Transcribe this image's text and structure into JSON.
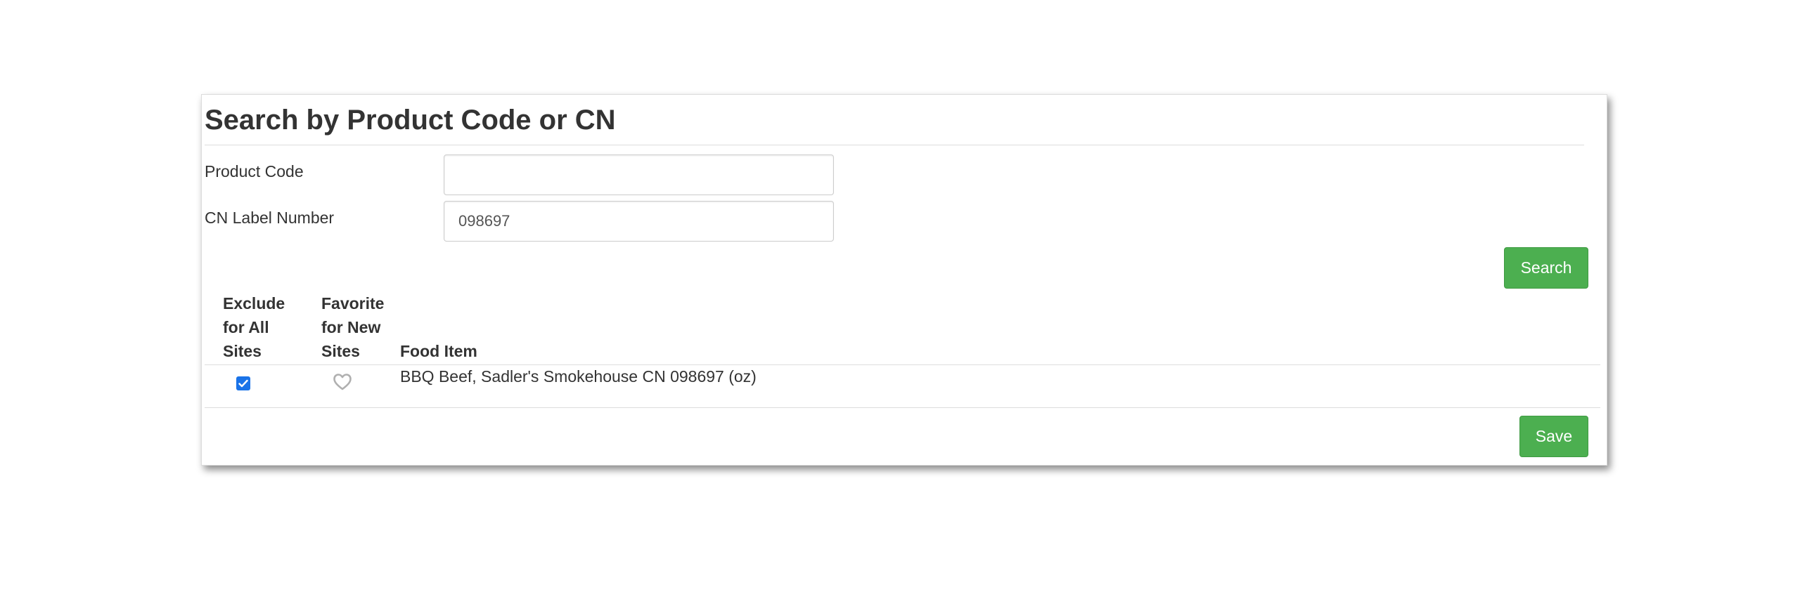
{
  "search_section": {
    "title": "Search by Product Code or CN",
    "product_code": {
      "label": "Product Code",
      "value": ""
    },
    "cn_label_number": {
      "label": "CN Label Number",
      "value": "098697"
    },
    "search_button_label": "Search"
  },
  "results_table": {
    "headers": {
      "exclude": [
        "Exclude",
        "for All",
        "Sites"
      ],
      "favorite": [
        "Favorite",
        "for New",
        "Sites"
      ],
      "food_item": "Food Item"
    },
    "rows": [
      {
        "excluded": true,
        "favorite": false,
        "food_item": "BBQ Beef, Sadler's Smokehouse CN 098697 (oz)"
      }
    ]
  },
  "save_button_label": "Save",
  "colors": {
    "button_green": "#4caf50",
    "checkbox_blue": "#1a73e8",
    "text": "#333333",
    "heart_outline": "#b0b0b0"
  }
}
